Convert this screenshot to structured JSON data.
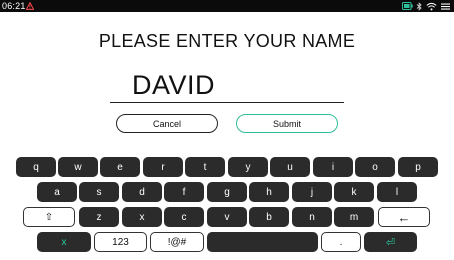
{
  "status": {
    "time": "06:21"
  },
  "prompt": "PLEASE ENTER YOUR NAME",
  "name_value": "DAVID",
  "buttons": {
    "cancel": "Cancel",
    "submit": "Submit"
  },
  "keyboard": {
    "row1": [
      "q",
      "w",
      "e",
      "r",
      "t",
      "y",
      "u",
      "i",
      "o",
      "p"
    ],
    "row2": [
      "a",
      "s",
      "d",
      "f",
      "g",
      "h",
      "j",
      "k",
      "l"
    ],
    "row3": {
      "shift": "⇧",
      "letters": [
        "z",
        "x",
        "c",
        "v",
        "b",
        "n",
        "m"
      ],
      "backspace": "←"
    },
    "row4": {
      "close": "x",
      "numbers": "123",
      "symbols": "!@#",
      "space": "",
      "period": ".",
      "enter": "⏎"
    }
  },
  "colors": {
    "accent": "#2fbf9a",
    "key_dark": "#2b2b2b",
    "statusbar": "#0b0b0b"
  }
}
